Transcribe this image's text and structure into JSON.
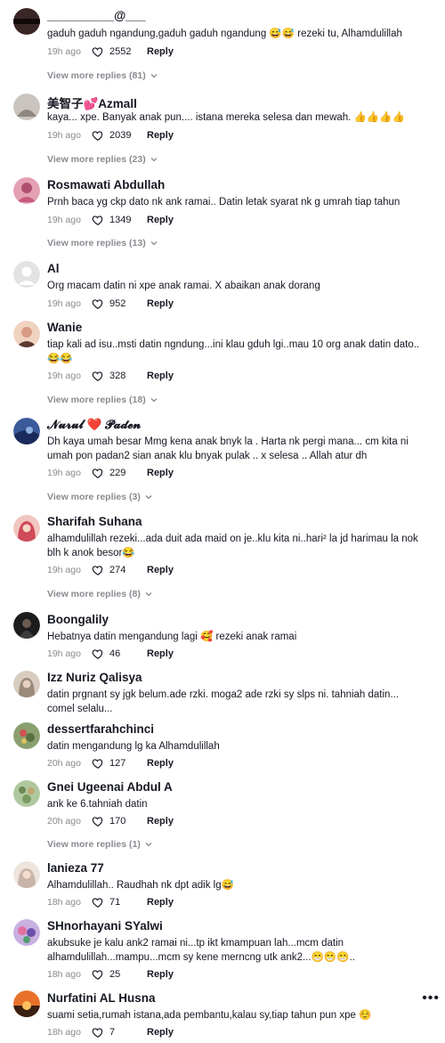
{
  "comments": [
    {
      "name": "__________@___",
      "text": "gaduh gaduh ngandung,gaduh gaduh ngandung 😅😅 rezeki tu, Alhamdulillah",
      "time": "19h ago",
      "likes": "2552",
      "reply": "Reply",
      "more": "View more replies (81)",
      "avatar_color": "#3a2a2a"
    },
    {
      "name": "美智子💕Azmall",
      "text": "kaya... xpe. Banyak anak pun.... istana mereka selesa dan mewah. 👍👍👍👍",
      "time": "19h ago",
      "likes": "2039",
      "reply": "Reply",
      "more": "View more replies (23)",
      "avatar_color": "#c8c2bc"
    },
    {
      "name": "Rosmawati Abdullah",
      "text": "Prnh baca yg ckp dato nk ank ramai.. Datin letak syarat nk g umrah tiap tahun",
      "time": "19h ago",
      "likes": "1349",
      "reply": "Reply",
      "more": "View more replies (13)",
      "avatar_color": "#d86a8a"
    },
    {
      "name": "Al",
      "text": "Org macam datin ni xpe anak ramai. X abaikan anak dorang",
      "time": "19h ago",
      "likes": "952",
      "reply": "Reply",
      "more": "",
      "avatar_color": "#dcdcdc"
    },
    {
      "name": "Wanie",
      "text": "tiap kali ad isu..msti datin ngndung...ini klau gduh lgi..mau 10 org anak datin dato.. 😂😂",
      "time": "19h ago",
      "likes": "328",
      "reply": "Reply",
      "more": "View more replies (18)",
      "avatar_color": "#e8b8a0"
    },
    {
      "name": "𝓝𝓾𝓻𝓾𝓵 ❤️ 𝓟𝓪𝓭𝓮𝓷",
      "text": "Dh kaya umah besar Mmg kena anak bnyk la . Harta nk pergi mana... cm kita ni umah pon padan2 sian anak klu bnyak pulak .. x selesa .. Allah atur dh",
      "time": "19h ago",
      "likes": "229",
      "reply": "Reply",
      "more": "View more replies (3)",
      "avatar_color": "#2a4a7a"
    },
    {
      "name": "Sharifah Suhana",
      "text": "alhamdulillah rezeki...ada duit ada maid on je..klu kita ni..hari² la jd harimau la nok blh k anok besor😂",
      "time": "19h ago",
      "likes": "274",
      "reply": "Reply",
      "more": "View more replies (8)",
      "avatar_color": "#d88a8a"
    },
    {
      "name": "Boongalily",
      "text": "Hebatnya datin mengandung lagi 🥰 rezeki anak ramai",
      "time": "19h ago",
      "likes": "46",
      "reply": "Reply",
      "more": "",
      "avatar_color": "#1a1a1a"
    },
    {
      "name": "Izz Nuriz Qalisya",
      "text": "datin prgnant sy jgk belum.ade rzki. moga2 ade rzki sy slps ni. tahniah datin... comel selalu...",
      "time": "",
      "likes": "",
      "reply": "",
      "more": "",
      "avatar_color": "#b8a898"
    },
    {
      "name": "dessertfarahchinci",
      "text": "datin mengandung lg ka Alhamdulillah",
      "time": "20h ago",
      "likes": "127",
      "reply": "Reply",
      "more": "",
      "avatar_color": "#6a8a5a"
    },
    {
      "name": "Gnei Ugeenai Abdul A",
      "text": "ank ke 6.tahniah datin",
      "time": "20h ago",
      "likes": "170",
      "reply": "Reply",
      "more": "View more replies (1)",
      "avatar_color": "#7a9a6a"
    },
    {
      "name": "lanieza 77",
      "text": "Alhamdulillah.. Raudhah nk dpt adik lg😅",
      "time": "18h ago",
      "likes": "71",
      "reply": "Reply",
      "more": "",
      "avatar_color": "#d8c8c0"
    },
    {
      "name": "SHnorhayani SYalwi",
      "text": "akubsuke je kalu ank2 ramai ni...tp ikt kmampuan lah...mcm datin alhamdulillah...mampu...mcm sy kene merncng utk ank2...😁😁😁..",
      "time": "18h ago",
      "likes": "25",
      "reply": "Reply",
      "more": "",
      "avatar_color": "#8a6ab8"
    },
    {
      "name": "Nurfatini AL Husna",
      "text": "suami setia,rumah istana,ada pembantu,kalau sy,tiap tahun pun xpe ☺️",
      "time": "18h ago",
      "likes": "7",
      "reply": "Reply",
      "more": "",
      "avatar_color": "#d86a2a"
    }
  ],
  "more_options": "•••"
}
